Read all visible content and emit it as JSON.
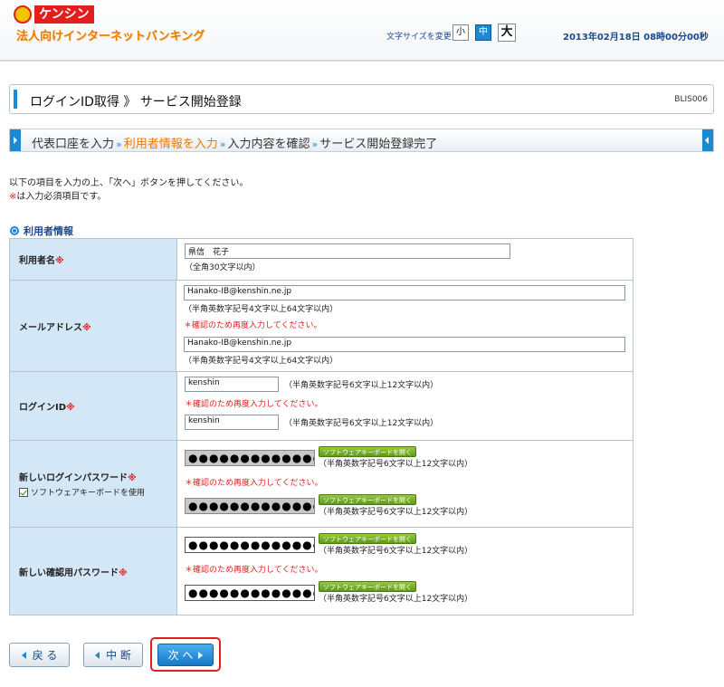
{
  "header": {
    "logo_text": "ケンシン",
    "service_name": "法人向けインターネットバンキング",
    "font_size_label": "文字サイズを変更",
    "font_sizes": [
      "小",
      "中",
      "大"
    ],
    "datetime": "2013年02月18日 08時00分00秒"
  },
  "page": {
    "title": "ログインID取得 》 サービス開始登録",
    "screen_id": "BLIS006"
  },
  "steps": [
    "代表口座を入力",
    "利用者情報を入力",
    "入力内容を確認",
    "サービス開始登録完了"
  ],
  "steps_current": 1,
  "intro": {
    "line1": "以下の項目を入力の上、「次へ」ボタンを押してください。",
    "req_mark": "※",
    "line2": "は入力必須項目です。"
  },
  "section_title": "利用者情報",
  "form": {
    "req_mark": "※",
    "recheck": "＊確認のため再度入力してください。",
    "kb_button": "ソフトウェアキーボードを開く",
    "user_name": {
      "label": "利用者名",
      "value": "県信　花子",
      "note": "（全角30文字以内）"
    },
    "email": {
      "label": "メールアドレス",
      "value": "Hanako-IB@kenshin.ne.jp",
      "confirm_value": "Hanako-IB@kenshin.ne.jp",
      "note": "（半角英数字記号4文字以上64文字以内）"
    },
    "login_id": {
      "label": "ログインID",
      "value": "kenshin",
      "confirm_value": "kenshin",
      "note": "（半角英数字記号6文字以上12文字以内）"
    },
    "new_password": {
      "label": "新しいログインパスワード",
      "mask": "●●●●●●●●●●●●●",
      "checkbox_label": "ソフトウェアキーボードを使用",
      "note": "（半角英数字記号6文字以上12文字以内）"
    },
    "confirm_password": {
      "label": "新しい確認用パスワード",
      "mask": "●●●●●●●●●●●●●",
      "note": "（半角英数字記号6文字以上12文字以内）"
    }
  },
  "buttons": {
    "back": "戻 る",
    "cancel": "中 断",
    "next": "次 へ"
  },
  "colors": {
    "accent_blue": "#1a8ad4",
    "brand_red": "#e21e1e",
    "current_step": "#e87a00",
    "kb_green": "#6aa624"
  }
}
